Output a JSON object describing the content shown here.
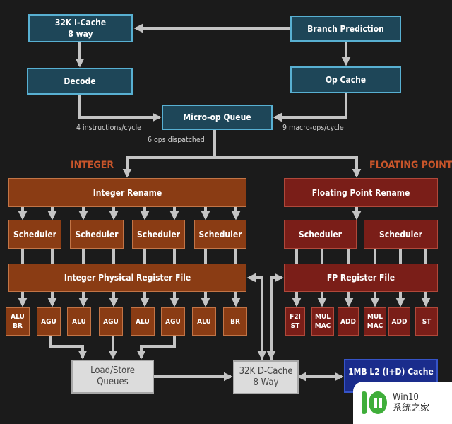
{
  "frontend": {
    "icache": [
      "32K I-Cache",
      "8 way"
    ],
    "branch_prediction": "Branch Prediction",
    "decode": "Decode",
    "op_cache": "Op Cache",
    "micro_op_queue": "Micro-op Queue",
    "decode_rate": "4 instructions/cycle",
    "op_cache_rate": "9 macro-ops/cycle",
    "dispatch_rate": "6 ops dispatched"
  },
  "integer": {
    "section_label": "INTEGER",
    "rename": "Integer Rename",
    "schedulers": [
      "Scheduler",
      "Scheduler",
      "Scheduler",
      "Scheduler"
    ],
    "register_file": "Integer Physical Register File",
    "units": [
      [
        "ALU",
        "BR"
      ],
      [
        "AGU"
      ],
      [
        "ALU"
      ],
      [
        "AGU"
      ],
      [
        "ALU"
      ],
      [
        "AGU"
      ],
      [
        "ALU"
      ],
      [
        "BR"
      ]
    ]
  },
  "floating_point": {
    "section_label": "FLOATING POINT",
    "rename": "Floating Point Rename",
    "schedulers": [
      "Scheduler",
      "Scheduler"
    ],
    "register_file": "FP Register File",
    "units": [
      [
        "F2I",
        "ST"
      ],
      [
        "MUL",
        "MAC"
      ],
      [
        "ADD"
      ],
      [
        "MUL",
        "MAC"
      ],
      [
        "ADD"
      ],
      [
        "ST"
      ]
    ]
  },
  "memory": {
    "load_store": [
      "Load/Store",
      "Queues"
    ],
    "dcache": [
      "32K D-Cache",
      "8 Way"
    ],
    "l2": "1MB L2 (I+D) Cache"
  },
  "watermark": {
    "line1": "Win10",
    "line2": "系统之家"
  },
  "colors": {
    "background": "#1b1b1b",
    "frontend": "#1e4658",
    "frontend_border": "#58b0d2",
    "integer": "#8a3c14",
    "floating_point": "#7a1e18",
    "memory": "#dcdcdc",
    "l2": "#1a2c8c",
    "arrow": "#c4c4c4",
    "section_label": "#c8552a"
  }
}
